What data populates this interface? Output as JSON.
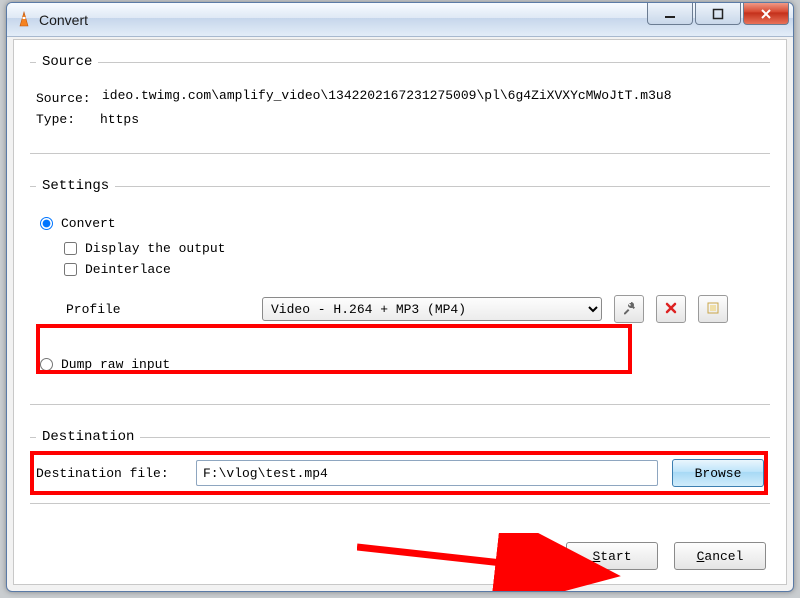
{
  "window": {
    "title": "Convert"
  },
  "source": {
    "legend": "Source",
    "source_label": "Source:",
    "source_value": "ideo.twimg.com\\amplify_video\\1342202167231275009\\pl\\6g4ZiXVXYcMWoJtT.m3u8",
    "type_label": "Type:",
    "type_value": "https"
  },
  "settings": {
    "legend": "Settings",
    "convert_label": "Convert",
    "display_output_label": "Display the output",
    "deinterlace_label": "Deinterlace",
    "profile_label": "Profile",
    "profile_value": "Video - H.264 + MP3 (MP4)",
    "dump_raw_label": "Dump raw input"
  },
  "destination": {
    "legend": "Destination",
    "file_label": "Destination file:",
    "file_value": "F:\\vlog\\test.mp4",
    "browse_label": "Browse"
  },
  "footer": {
    "start_label": "Start",
    "cancel_label": "Cancel"
  }
}
